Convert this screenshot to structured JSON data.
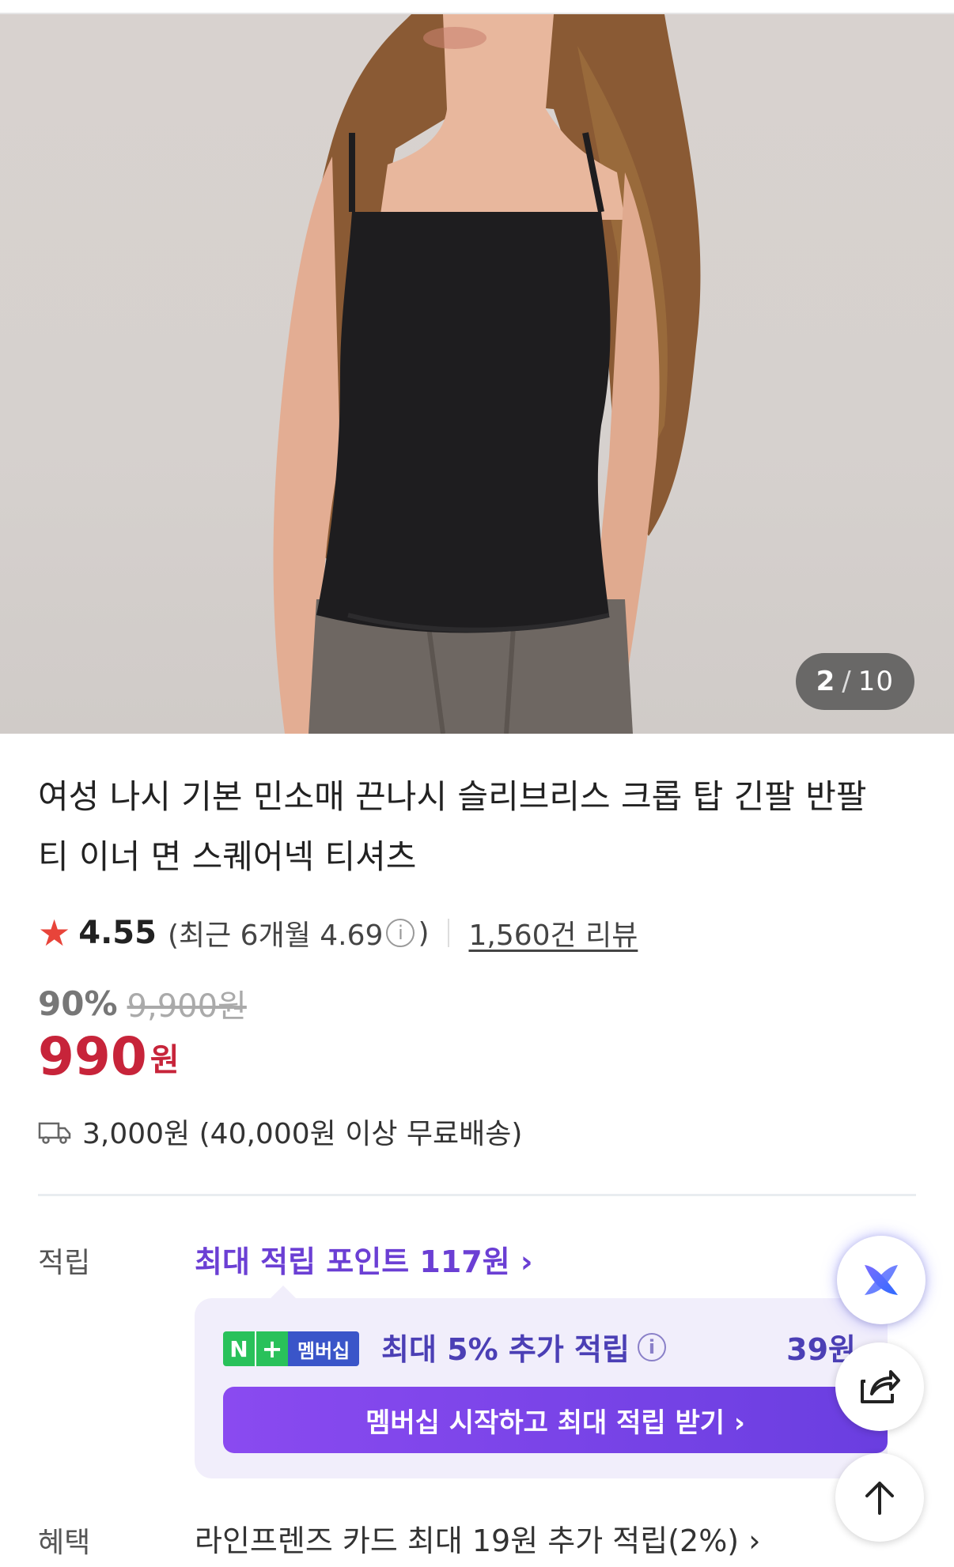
{
  "gallery": {
    "current": "2",
    "separator": "/",
    "total": "10"
  },
  "product": {
    "title": "여성 나시 기본 민소매 끈나시 슬리브리스 크롭 탑 긴팔 반팔 티 이너 면 스퀘어넥 티셔츠"
  },
  "rating": {
    "star_icon": "star-icon",
    "score": "4.55",
    "recent_prefix": "(최근 6개월 4.69",
    "recent_suffix": ")",
    "info_icon": "info-icon",
    "reviews": "1,560건 리뷰"
  },
  "price": {
    "discount": "90%",
    "original": "9,900원",
    "sale": "990",
    "currency": "원"
  },
  "shipping": {
    "icon": "truck-icon",
    "text": "3,000원 (40,000원 이상 무료배송)"
  },
  "points": {
    "label": "적립",
    "link": "최대 적립 포인트 117원 ›"
  },
  "membership": {
    "badge_n": "N",
    "badge_plus": "+",
    "badge_label": "멤버십",
    "text": "최대 5% 추가 적립",
    "amount": "39원",
    "button": "멤버십 시작하고 최대 적립 받기 ›"
  },
  "benefit": {
    "label": "혜택",
    "text": "라인프렌즈 카드 최대 19원 추가 적립(2%) ›"
  },
  "floating": {
    "ai_icon": "ai-assistant-icon",
    "share_icon": "share-icon",
    "top_icon": "arrow-up-icon"
  },
  "colors": {
    "accent_purple": "#6b3fd4",
    "price_red": "#c7243a",
    "star_red": "#e8443a",
    "npay_green": "#29c15a"
  }
}
